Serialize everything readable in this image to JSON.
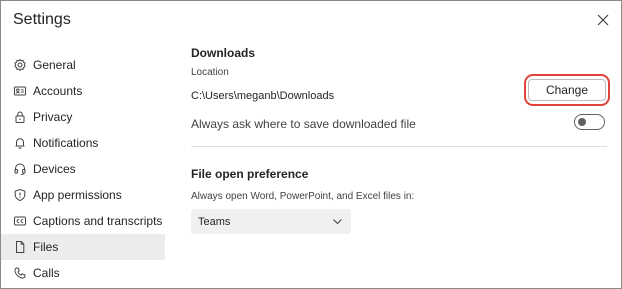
{
  "window": {
    "title": "Settings",
    "close_icon": "close-icon"
  },
  "sidebar": {
    "items": [
      {
        "label": "General",
        "icon": "gear-icon"
      },
      {
        "label": "Accounts",
        "icon": "id-card-icon"
      },
      {
        "label": "Privacy",
        "icon": "lock-icon"
      },
      {
        "label": "Notifications",
        "icon": "bell-icon"
      },
      {
        "label": "Devices",
        "icon": "headset-icon"
      },
      {
        "label": "App permissions",
        "icon": "shield-icon"
      },
      {
        "label": "Captions and transcripts",
        "icon": "captions-icon"
      },
      {
        "label": "Files",
        "icon": "file-icon",
        "selected": true
      },
      {
        "label": "Calls",
        "icon": "phone-icon"
      }
    ]
  },
  "downloads": {
    "title": "Downloads",
    "location_label": "Location",
    "path": "C:\\Users\\meganb\\Downloads",
    "change_label": "Change",
    "ask_label": "Always ask where to save downloaded file",
    "ask_enabled": false
  },
  "file_open": {
    "title": "File open preference",
    "description": "Always open Word, PowerPoint, and Excel files in:",
    "selected": "Teams"
  },
  "colors": {
    "highlight_ring": "#e0433b",
    "selected_nav_bg": "#ececec",
    "select_bg": "#f0f0f0"
  }
}
